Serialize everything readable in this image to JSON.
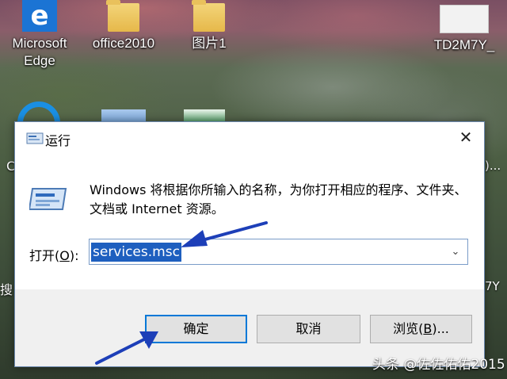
{
  "desktop": {
    "icons": [
      {
        "label_line1": "Microsoft",
        "label_line2": "Edge",
        "icon": "edge-icon"
      },
      {
        "label_line1": "office2010",
        "icon": "folder-icon"
      },
      {
        "label_line1": "图片1",
        "icon": "folder-icon"
      },
      {
        "label_line1": "TD2M7Y_",
        "icon": "image-thumbnail-icon"
      }
    ],
    "side_fragments": {
      "left_c": "C",
      "left_sou": "搜",
      "right_paren": ")...",
      "right_7y": "7Y"
    }
  },
  "dialog": {
    "title": "运行",
    "description": "Windows 将根据你所输入的名称，为你打开相应的程序、文件夹、文档或 Internet 资源。",
    "open_label_prefix": "打开(",
    "open_label_key": "O",
    "open_label_suffix": "):",
    "input_value": "services.msc",
    "buttons": {
      "ok_label": "确定",
      "cancel_label": "取消",
      "browse_prefix": "浏览(",
      "browse_key": "B",
      "browse_suffix": ")..."
    },
    "close_glyph": "✕",
    "dropdown_glyph": "⌄"
  },
  "annotations": {
    "arrow_color": "#1d3fb8"
  },
  "watermark": "头条 @佐佐佑佑2015"
}
